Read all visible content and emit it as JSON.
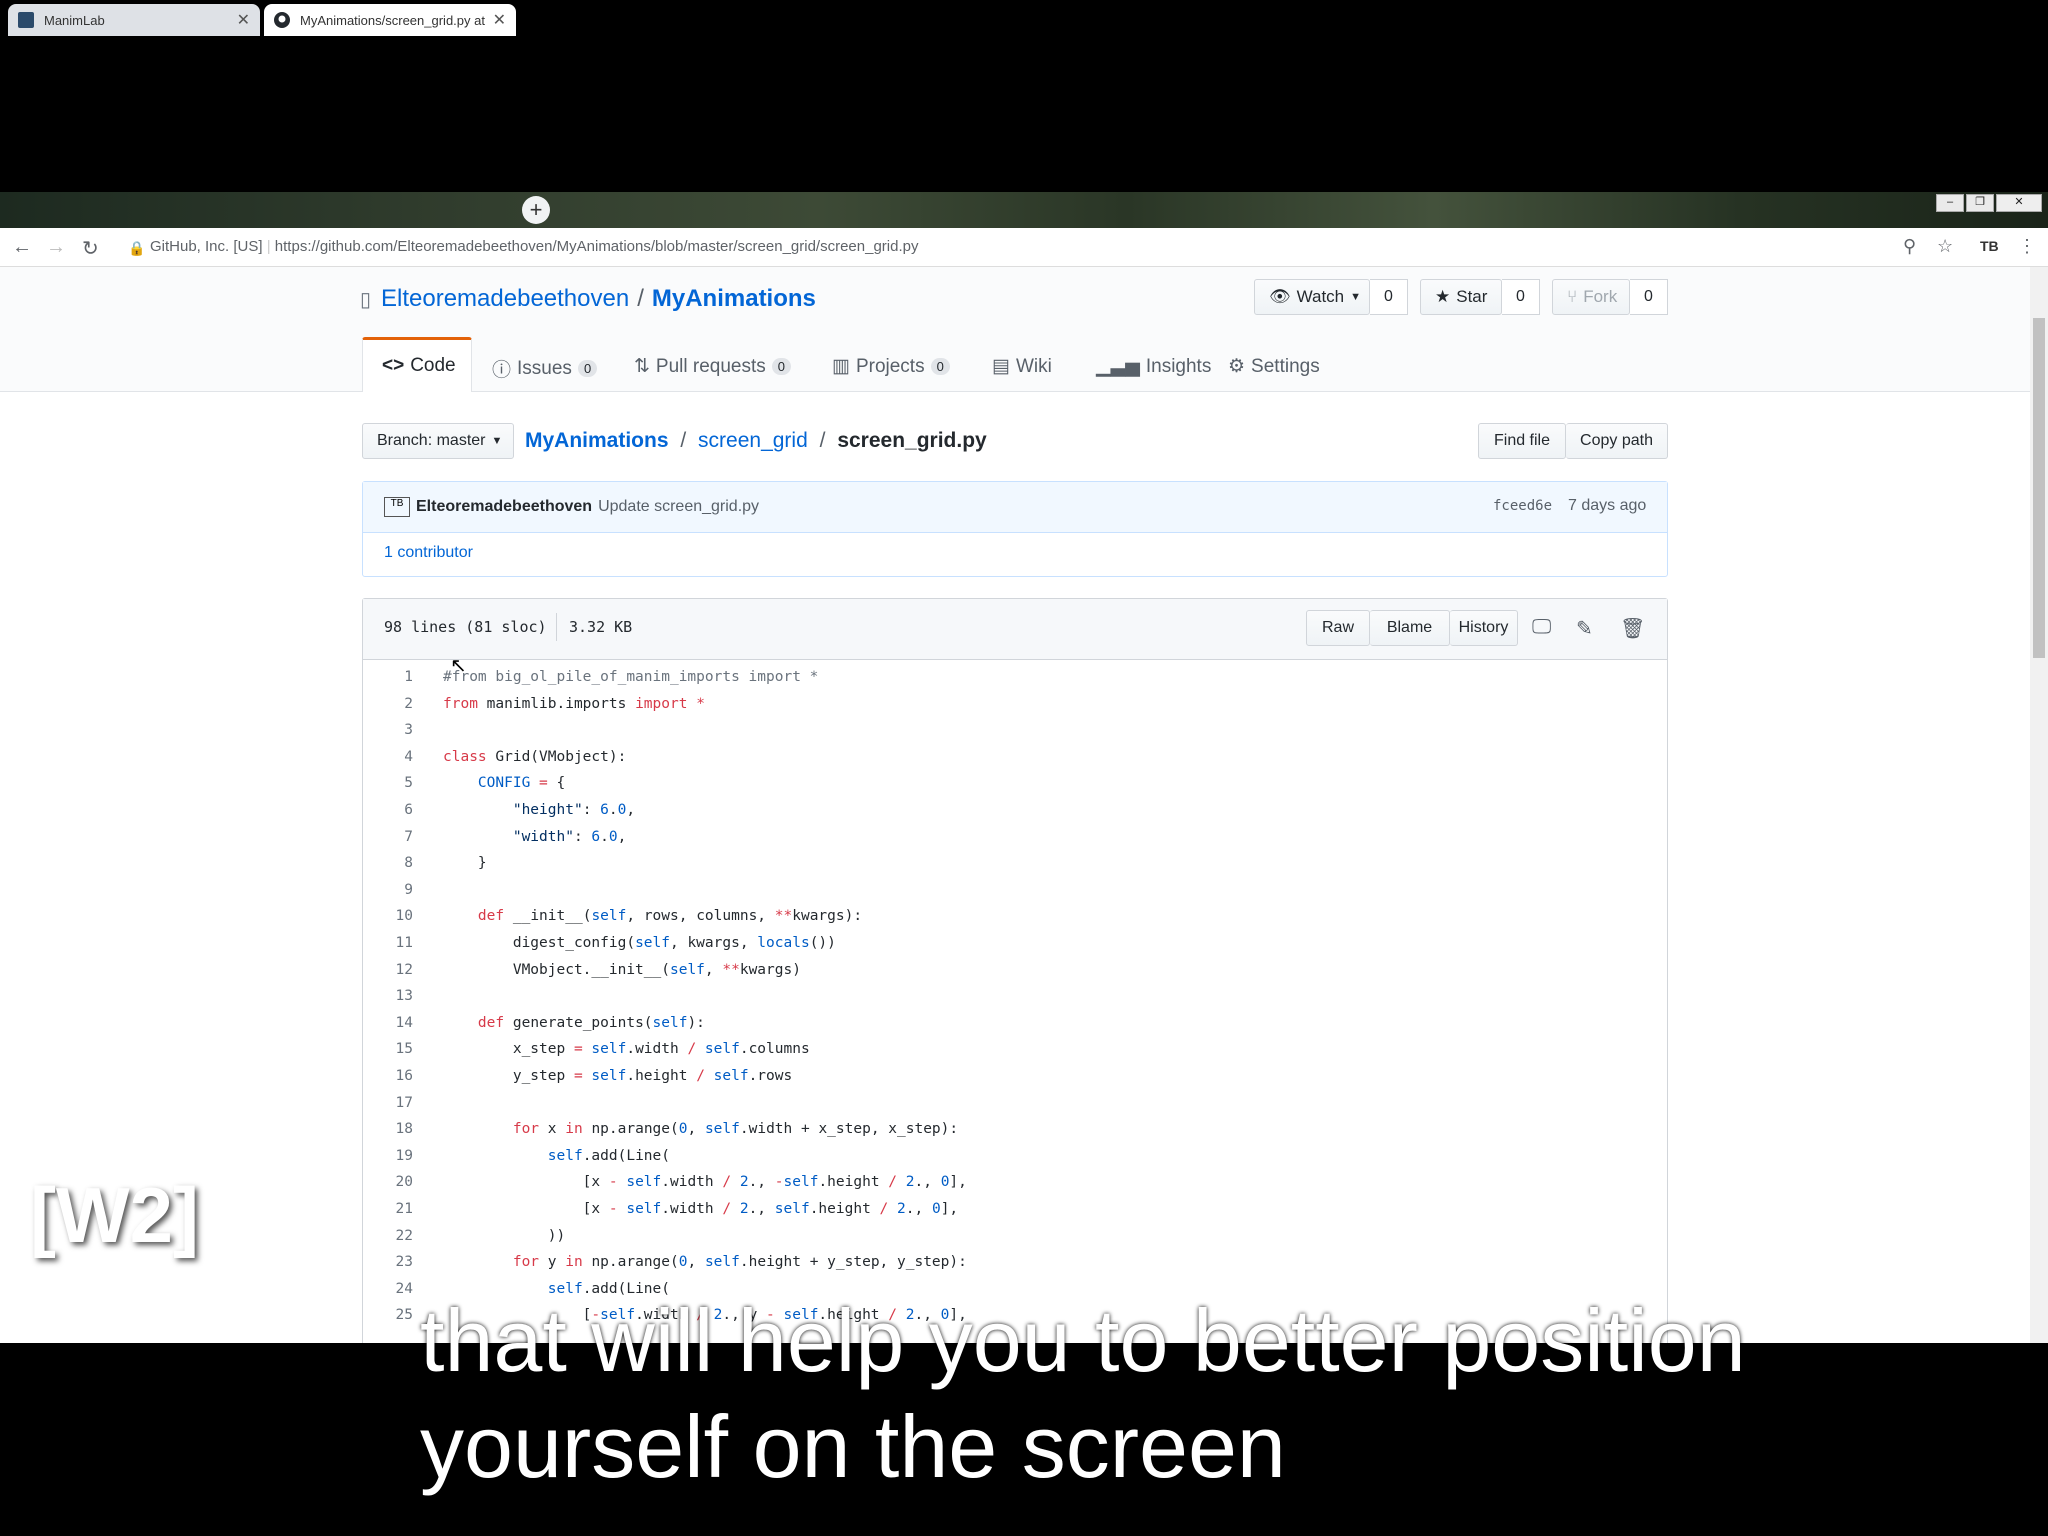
{
  "browser": {
    "tabs": [
      {
        "title": "ManimLab"
      },
      {
        "title": "MyAnimations/screen_grid.py at"
      }
    ],
    "address": {
      "security": "GitHub, Inc. [US]",
      "url": "https://github.com/Elteoremadebeethoven/MyAnimations/blob/master/screen_grid/screen_grid.py"
    }
  },
  "repo": {
    "owner": "Elteoremadebeethoven",
    "separator": "/",
    "name": "MyAnimations",
    "watch_label": "Watch",
    "watch_count": "0",
    "star_label": "Star",
    "star_count": "0",
    "fork_label": "Fork",
    "fork_count": "0"
  },
  "nav": {
    "code": "Code",
    "issues": "Issues",
    "issues_count": "0",
    "pulls": "Pull requests",
    "pulls_count": "0",
    "projects": "Projects",
    "projects_count": "0",
    "wiki": "Wiki",
    "insights": "Insights",
    "settings": "Settings"
  },
  "file": {
    "branch_label": "Branch: master",
    "crumb_repo": "MyAnimations",
    "crumb_sep": "/",
    "crumb_dir": "screen_grid",
    "crumb_file": "screen_grid.py",
    "find_file": "Find file",
    "copy_path": "Copy path",
    "commit_author": "Elteoremadebeethoven",
    "commit_message": "Update screen_grid.py",
    "commit_sha": "fceed6e",
    "commit_time": "7 days ago",
    "contributors": "1 contributor",
    "lines_info": "98 lines (81 sloc)",
    "size": "3.32 KB",
    "raw": "Raw",
    "blame": "Blame",
    "history": "History"
  },
  "code_lines": [
    "#from big_ol_pile_of_manim_imports import *",
    "from manimlib.imports import *",
    "",
    "class Grid(VMobject):",
    "    CONFIG = {",
    "        \"height\": 6.0,",
    "        \"width\": 6.0,",
    "    }",
    "",
    "    def __init__(self, rows, columns, **kwargs):",
    "        digest_config(self, kwargs, locals())",
    "        VMobject.__init__(self, **kwargs)",
    "",
    "    def generate_points(self):",
    "        x_step = self.width / self.columns",
    "        y_step = self.height / self.rows",
    "",
    "        for x in np.arange(0, self.width + x_step, x_step):",
    "            self.add(Line(",
    "                [x - self.width / 2., -self.height / 2., 0],",
    "                [x - self.width / 2., self.height / 2., 0],",
    "            ))",
    "        for y in np.arange(0, self.height + y_step, y_step):",
    "            self.add(Line(",
    "                [-self.width / 2., y - self.height / 2., 0],"
  ],
  "overlay": {
    "label": "[W2]",
    "subtitle_line1": "that will help you to better position",
    "subtitle_line2": "yourself on the screen"
  }
}
